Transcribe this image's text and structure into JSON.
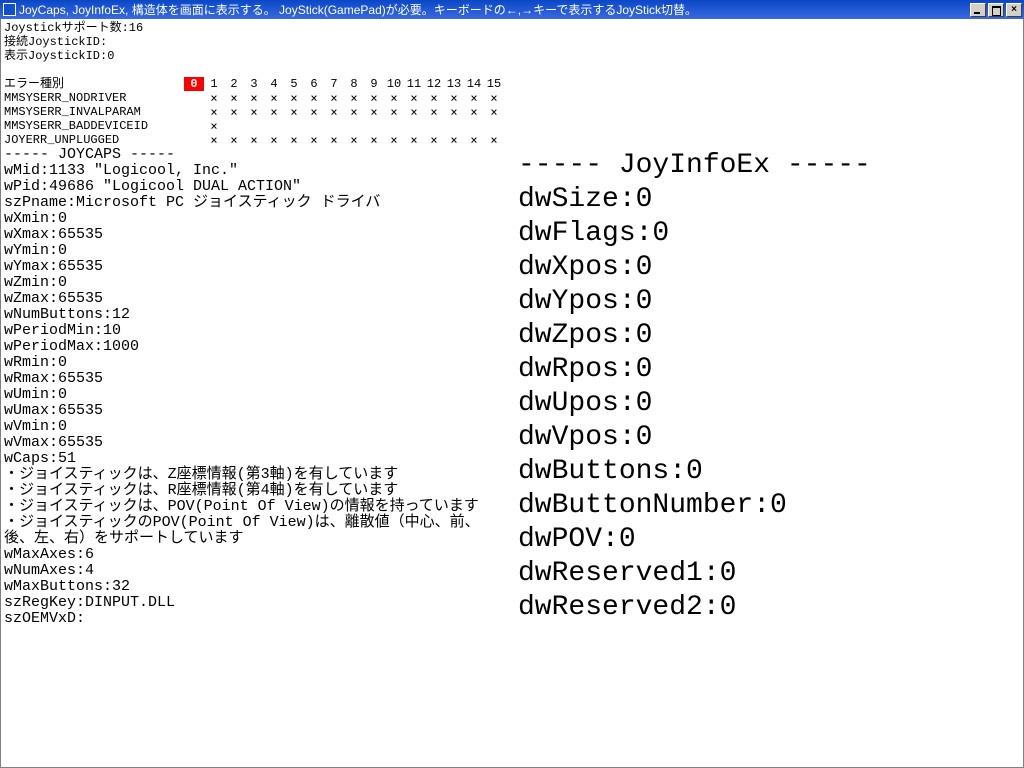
{
  "titlebar": {
    "title": "JoyCaps, JoyInfoEx, 構造体を画面に表示する。 JoyStick(GamePad)が必要。キーボードの←,→キーで表示するJoyStick切替。"
  },
  "top": {
    "l1": "Joystickサポート数:16",
    "l2": "接続JoystickID:",
    "l3": "表示JoystickID:0"
  },
  "matrix": {
    "header": "エラー種別",
    "cols": [
      "0",
      "1",
      "2",
      "3",
      "4",
      "5",
      "6",
      "7",
      "8",
      "9",
      "10",
      "11",
      "12",
      "13",
      "14",
      "15"
    ],
    "rows": [
      {
        "label": "MMSYSERR_NODRIVER",
        "cells": [
          "",
          "×",
          "×",
          "×",
          "×",
          "×",
          "×",
          "×",
          "×",
          "×",
          "×",
          "×",
          "×",
          "×",
          "×",
          "×"
        ]
      },
      {
        "label": "MMSYSERR_INVALPARAM",
        "cells": [
          "",
          "×",
          "×",
          "×",
          "×",
          "×",
          "×",
          "×",
          "×",
          "×",
          "×",
          "×",
          "×",
          "×",
          "×",
          "×"
        ]
      },
      {
        "label": "MMSYSERR_BADDEVICEID",
        "cells": [
          "",
          "×",
          "",
          "",
          "",
          "",
          "",
          "",
          "",
          "",
          "",
          "",
          "",
          "",
          "",
          ""
        ]
      },
      {
        "label": "JOYERR_UNPLUGGED",
        "cells": [
          "",
          "×",
          "×",
          "×",
          "×",
          "×",
          "×",
          "×",
          "×",
          "×",
          "×",
          "×",
          "×",
          "×",
          "×",
          "×"
        ]
      }
    ],
    "highlight_col": 0
  },
  "caps": {
    "header": "----- JOYCAPS -----",
    "wMid": "wMid:1133 \"Logicool, Inc.\"",
    "wPid": "wPid:49686 \"Logicool DUAL ACTION\"",
    "szPname": "szPname:Microsoft PC ジョイスティック ドライバ",
    "wXmin": "wXmin:0",
    "wXmax": "wXmax:65535",
    "wYmin": "wYmin:0",
    "wYmax": "wYmax:65535",
    "wZmin": "wZmin:0",
    "wZmax": "wZmax:65535",
    "wNumButtons": "wNumButtons:12",
    "wPeriodMin": "wPeriodMin:10",
    "wPeriodMax": "wPeriodMax:1000",
    "wRmin": "wRmin:0",
    "wRmax": "wRmax:65535",
    "wUmin": "wUmin:0",
    "wUmax": "wUmax:65535",
    "wVmin": "wVmin:0",
    "wVmax": "wVmax:65535",
    "wCaps": "wCaps:51",
    "cap1": "・ジョイスティックは、Z座標情報(第3軸)を有しています",
    "cap2": "・ジョイスティックは、R座標情報(第4軸)を有しています",
    "cap3": "・ジョイスティックは、POV(Point Of View)の情報を持っています",
    "cap4": "・ジョイスティックのPOV(Point Of View)は、離散値（中心、前、後、左、右）をサポートしています",
    "wMaxAxes": "wMaxAxes:6",
    "wNumAxes": "wNumAxes:4",
    "wMaxButtons": "wMaxButtons:32",
    "szRegKey": "szRegKey:DINPUT.DLL",
    "szOEMVxD": "szOEMVxD:"
  },
  "infoex": {
    "header": "----- JoyInfoEx -----",
    "dwSize": "dwSize:0",
    "dwFlags": "dwFlags:0",
    "dwXpos": "dwXpos:0",
    "dwYpos": "dwYpos:0",
    "dwZpos": "dwZpos:0",
    "dwRpos": "dwRpos:0",
    "dwUpos": "dwUpos:0",
    "dwVpos": "dwVpos:0",
    "dwButtons": "dwButtons:0",
    "dwButtonNumber": "dwButtonNumber:0",
    "dwPOV": "dwPOV:0",
    "dwReserved1": "dwReserved1:0",
    "dwReserved2": "dwReserved2:0"
  }
}
